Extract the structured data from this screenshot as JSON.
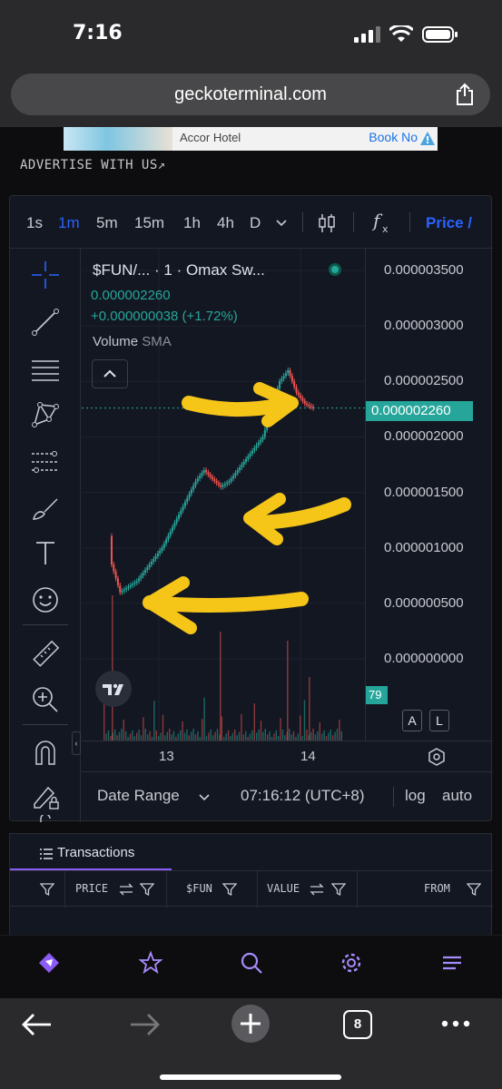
{
  "status": {
    "time": "7:16"
  },
  "browser": {
    "url": "geckoterminal.com",
    "tab_count": "8"
  },
  "ad": {
    "hotel": "Accor Hotel",
    "book": "Book No",
    "advertise": "ADVERTISE WITH US↗"
  },
  "chart_toolbar": {
    "timeframes": [
      "1s",
      "1m",
      "5m",
      "15m",
      "1h",
      "4h",
      "D"
    ],
    "active_timeframe": "1m",
    "price_tab": "Price /"
  },
  "chart": {
    "symbol": "$FUN/... · 1 · Omax Sw...",
    "price": "0.000002260",
    "change": "+0.000000038 (+1.72%)",
    "volume_label": "Volume",
    "volume_sma": "SMA",
    "current_price_label": "0.000002260",
    "volume_value": "79",
    "y_labels": [
      "0.000003500",
      "0.000003000",
      "0.000002500",
      "0.000002000",
      "0.000001500",
      "0.000001000",
      "0.000000500",
      "0.000000000"
    ],
    "x_labels": [
      "13",
      "14"
    ],
    "scale_a": "A",
    "scale_l": "L",
    "date_range": "Date Range",
    "clock": "07:16:12 (UTC+8)",
    "log": "log",
    "auto": "auto",
    "colors": {
      "up": "#26a69a",
      "down": "#ef5350",
      "annotation": "#f5c518"
    }
  },
  "chart_data": {
    "type": "candlestick",
    "title": "$FUN/... · 1 · Omax Sw...",
    "x_ticks": [
      "13",
      "14"
    ],
    "ylim": [
      0,
      3.5e-06
    ],
    "last_price": 2.26e-06,
    "series": [
      {
        "name": "price",
        "values": [
          8.5e-07,
          6e-07,
          6.5e-07,
          7e-07,
          8e-07,
          9e-07,
          1e-06,
          1.15e-06,
          1.3e-06,
          1.45e-06,
          1.6e-06,
          1.7e-06,
          1.62e-06,
          1.55e-06,
          1.6e-06,
          1.7e-06,
          1.8e-06,
          1.9e-06,
          2e-06,
          2.25e-06,
          2.5e-06,
          2.6e-06,
          2.4e-06,
          2.3e-06,
          2.26e-06
        ]
      }
    ]
  },
  "transactions": {
    "tab": "Transactions",
    "columns": [
      "PRICE",
      "$FUN",
      "VALUE",
      "FROM"
    ]
  }
}
